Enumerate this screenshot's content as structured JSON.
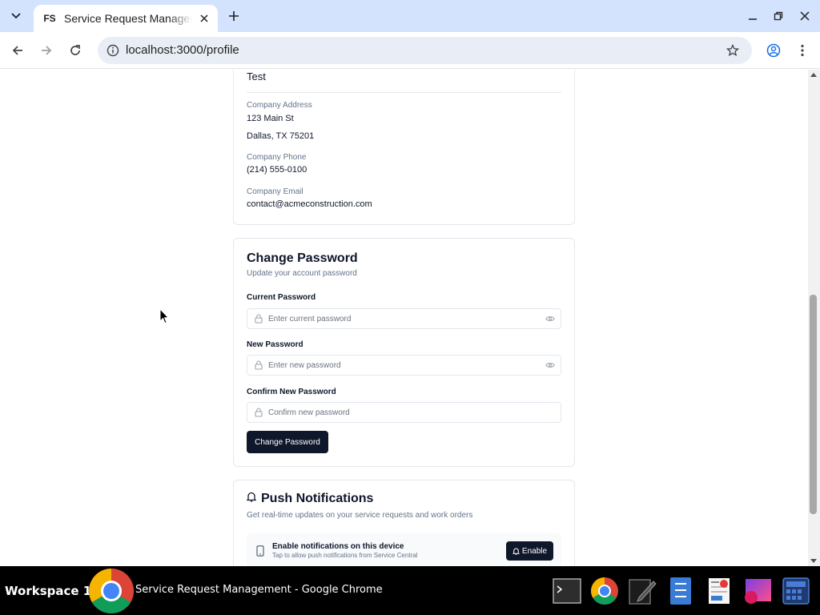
{
  "browser": {
    "tab_title": "Service Request Management",
    "favicon_text": "FS",
    "url": "localhost:3000/profile"
  },
  "company": {
    "name": "Test",
    "address_label": "Company Address",
    "address_line1": "123 Main St",
    "address_line2": "Dallas, TX 75201",
    "phone_label": "Company Phone",
    "phone": "(214) 555-0100",
    "email_label": "Company Email",
    "email": "contact@acmeconstruction.com"
  },
  "change_password": {
    "title": "Change Password",
    "subtitle": "Update your account password",
    "current_label": "Current Password",
    "current_placeholder": "Enter current password",
    "new_label": "New Password",
    "new_placeholder": "Enter new password",
    "confirm_label": "Confirm New Password",
    "confirm_placeholder": "Confirm new password",
    "submit_label": "Change Password"
  },
  "push": {
    "title": "Push Notifications",
    "subtitle": "Get real-time updates on your service requests and work orders",
    "row_title": "Enable notifications on this device",
    "row_hint": "Tap to allow push notifications from Service Central",
    "enable_label": "Enable"
  },
  "taskbar": {
    "workspace": "Workspace 1",
    "window_title": "Service Request Management - Google Chrome"
  },
  "colors": {
    "primary": "#0f172a",
    "tabstrip": "#d3e3fd",
    "muted": "#64748b"
  },
  "icons": [
    "tab-search-icon",
    "close-icon",
    "plus-icon",
    "minimize-icon",
    "restore-icon",
    "back-icon",
    "forward-icon",
    "reload-icon",
    "info-icon",
    "star-icon",
    "profile-icon",
    "menu-icon",
    "lock-icon",
    "eye-icon",
    "bell-icon",
    "phone-icon"
  ]
}
